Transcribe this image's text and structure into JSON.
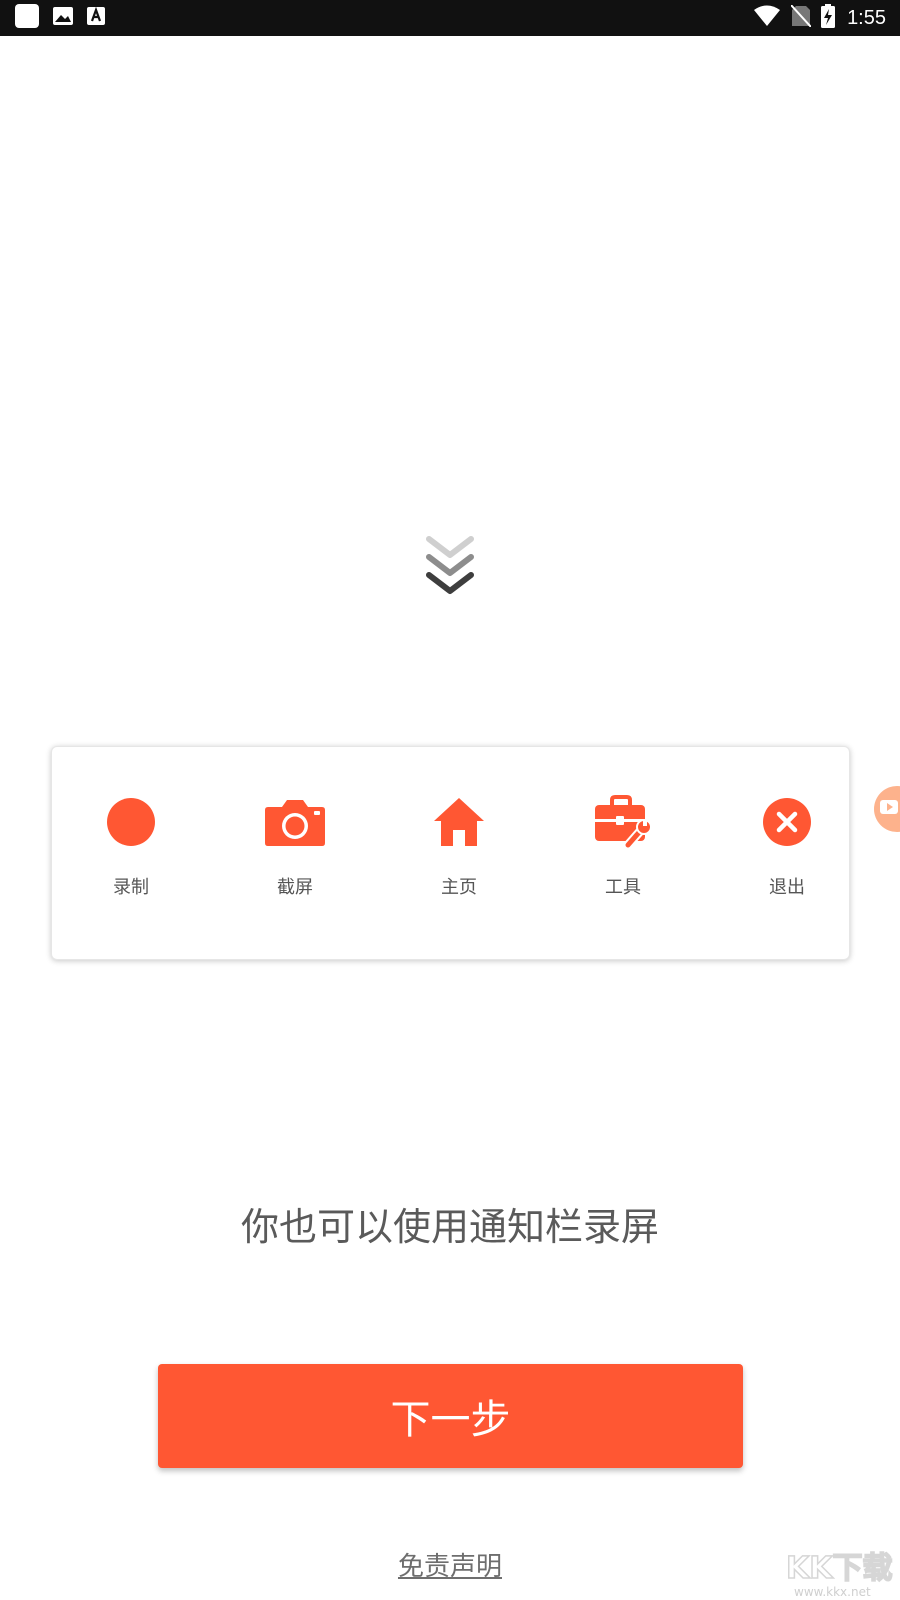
{
  "status_bar": {
    "time": "1:55",
    "icons": [
      "app-square-icon",
      "image-icon",
      "text-a-icon",
      "wifi-icon",
      "no-sim-icon",
      "battery-charging-icon"
    ]
  },
  "colors": {
    "accent": "#ff5733",
    "text_gray": "#5a5a5a",
    "label_gray": "#555555",
    "status_bar": "#111111"
  },
  "panel": {
    "items": [
      {
        "label": "录制",
        "icon": "record-dot-icon"
      },
      {
        "label": "截屏",
        "icon": "camera-icon"
      },
      {
        "label": "主页",
        "icon": "home-icon"
      },
      {
        "label": "工具",
        "icon": "toolbox-icon"
      },
      {
        "label": "退出",
        "icon": "close-circle-icon"
      }
    ]
  },
  "hint": {
    "text": "你也可以使用通知栏录屏"
  },
  "next_button": {
    "label": "下一步"
  },
  "disclaimer": {
    "label": "免责声明"
  },
  "watermark": {
    "text": "KK下载",
    "url_text": "www.kkx.net"
  }
}
